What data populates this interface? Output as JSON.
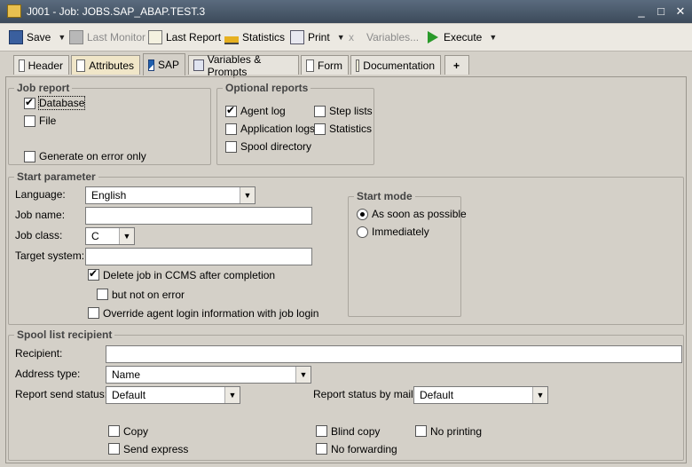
{
  "window": {
    "title": "J001 - Job: JOBS.SAP_ABAP.TEST.3",
    "controls": [
      "_",
      "□",
      "✕"
    ]
  },
  "toolbar": {
    "save": "Save",
    "last_monitor": "Last Monitor",
    "last_report": "Last Report",
    "statistics": "Statistics",
    "print": "Print",
    "variables": "Variables...",
    "execute": "Execute"
  },
  "tabs": [
    "Header",
    "Attributes",
    "SAP",
    "Variables & Prompts",
    "Form",
    "Documentation",
    "+"
  ],
  "job_report": {
    "title": "Job report",
    "database": "Database",
    "file": "File",
    "generate_on_error": "Generate on error only"
  },
  "optional_reports": {
    "title": "Optional reports",
    "agent_log": "Agent log",
    "application_logs": "Application logs",
    "spool_directory": "Spool directory",
    "step_lists": "Step lists",
    "statistics": "Statistics"
  },
  "start_parameter": {
    "title": "Start parameter",
    "language_label": "Language:",
    "language_value": "English",
    "job_name_label": "Job name:",
    "job_name_value": "",
    "job_class_label": "Job class:",
    "job_class_value": "C",
    "target_system_label": "Target system:",
    "target_system_value": "",
    "delete_job": "Delete job in CCMS after completion",
    "but_not_on_error": "but not on error",
    "override_login": "Override agent login information with job login"
  },
  "start_mode": {
    "title": "Start mode",
    "asap": "As soon as possible",
    "immediately": "Immediately"
  },
  "spool": {
    "title": "Spool list recipient",
    "recipient_label": "Recipient:",
    "recipient_value": "",
    "address_type_label": "Address type:",
    "address_type_value": "Name",
    "report_send_status_label": "Report send status:",
    "report_send_status_value": "Default",
    "report_status_mail_label": "Report status by mail:",
    "report_status_mail_value": "Default",
    "copy": "Copy",
    "send_express": "Send express",
    "blind_copy": "Blind copy",
    "no_forwarding": "No forwarding",
    "no_printing": "No printing"
  }
}
